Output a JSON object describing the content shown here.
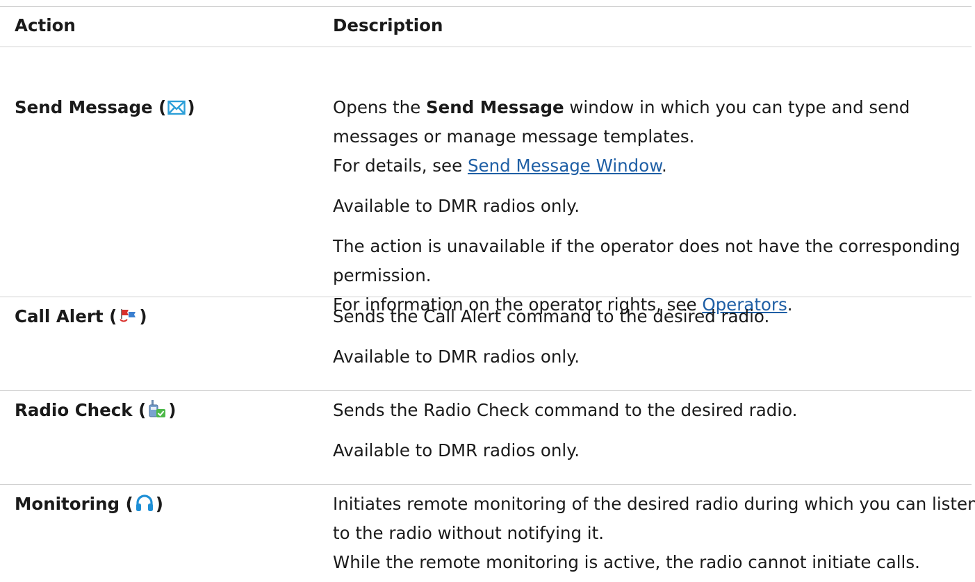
{
  "table": {
    "headers": {
      "action": "Action",
      "description": "Description"
    },
    "rows": [
      {
        "action": "Send Message",
        "icon": "envelope-icon",
        "description": {
          "p1a_pre": "Opens the ",
          "p1a_bold": "Send Message",
          "p1a_post": " window in which you can type and send",
          "p1b": "messages or manage message templates.",
          "p1c_pre": "For details, see ",
          "p1c_link": "Send Message Window",
          "p1c_post": ".",
          "p2": "Available to DMR radios only.",
          "p3a": "The action is unavailable if the operator does not have the corresponding",
          "p3b": "permission.",
          "p3c_pre": "For information on the operator rights, see ",
          "p3c_link": "Operators",
          "p3c_post": "."
        }
      },
      {
        "action": "Call Alert",
        "icon": "flag-alert-icon",
        "description": {
          "p1": "Sends the Call Alert command to the desired radio.",
          "p2": "Available to DMR radios only."
        }
      },
      {
        "action": "Radio Check",
        "icon": "radio-check-icon",
        "description": {
          "p1": "Sends the Radio Check command to the desired radio.",
          "p2": "Available to DMR radios only."
        }
      },
      {
        "action": "Monitoring",
        "icon": "headphones-icon",
        "description": {
          "p1a": "Initiates remote monitoring of the desired radio during which you can listen",
          "p1b": "to the radio without notifying it.",
          "p1c": "While the remote monitoring is active, the radio cannot initiate calls."
        }
      }
    ],
    "colors": {
      "link": "#1f5fa5",
      "border": "#d0d0d0",
      "text": "#1a1a1a"
    }
  }
}
